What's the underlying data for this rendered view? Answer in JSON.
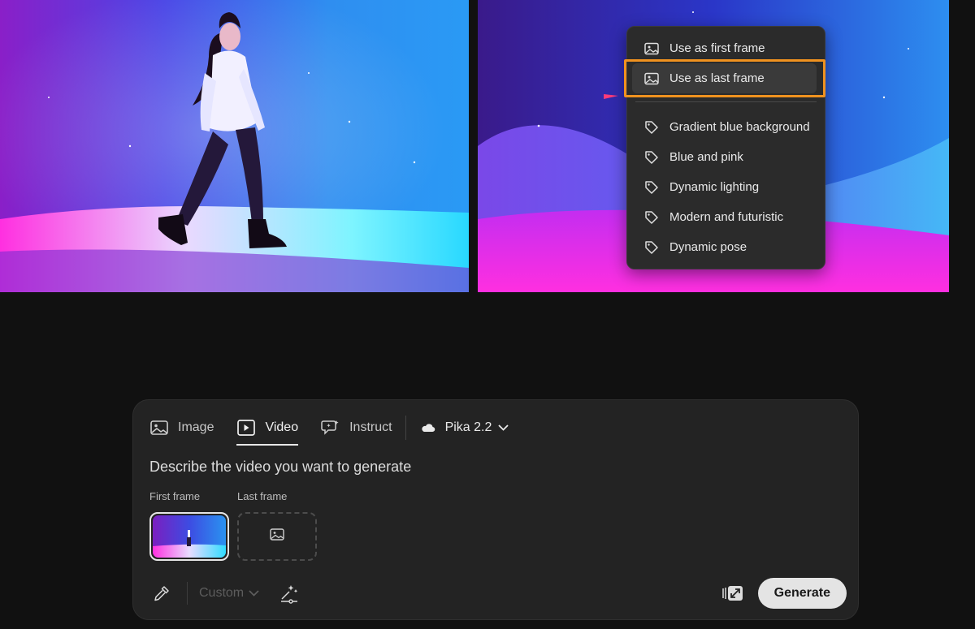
{
  "context_menu": {
    "items": [
      {
        "label": "Use as first frame",
        "icon": "image-icon"
      },
      {
        "label": "Use as last frame",
        "icon": "image-icon"
      }
    ],
    "tags": [
      {
        "label": "Gradient blue background",
        "icon": "tag-icon"
      },
      {
        "label": "Blue and pink",
        "icon": "tag-icon"
      },
      {
        "label": "Dynamic lighting",
        "icon": "tag-icon"
      },
      {
        "label": "Modern and futuristic",
        "icon": "tag-icon"
      },
      {
        "label": "Dynamic pose",
        "icon": "tag-icon"
      }
    ],
    "highlight_color": "#f0921f"
  },
  "tabs": [
    {
      "label": "Image",
      "icon": "image-icon"
    },
    {
      "label": "Video",
      "icon": "video-play-icon",
      "active": true
    },
    {
      "label": "Instruct",
      "icon": "instruct-chat-icon"
    }
  ],
  "model": {
    "label": "Pika 2.2",
    "icon": "cloud-icon"
  },
  "prompt": {
    "placeholder": "Describe the video you want to generate"
  },
  "frames": {
    "first_label": "First frame",
    "last_label": "Last frame"
  },
  "toolbar": {
    "style_label": "Custom",
    "generate_label": "Generate"
  }
}
